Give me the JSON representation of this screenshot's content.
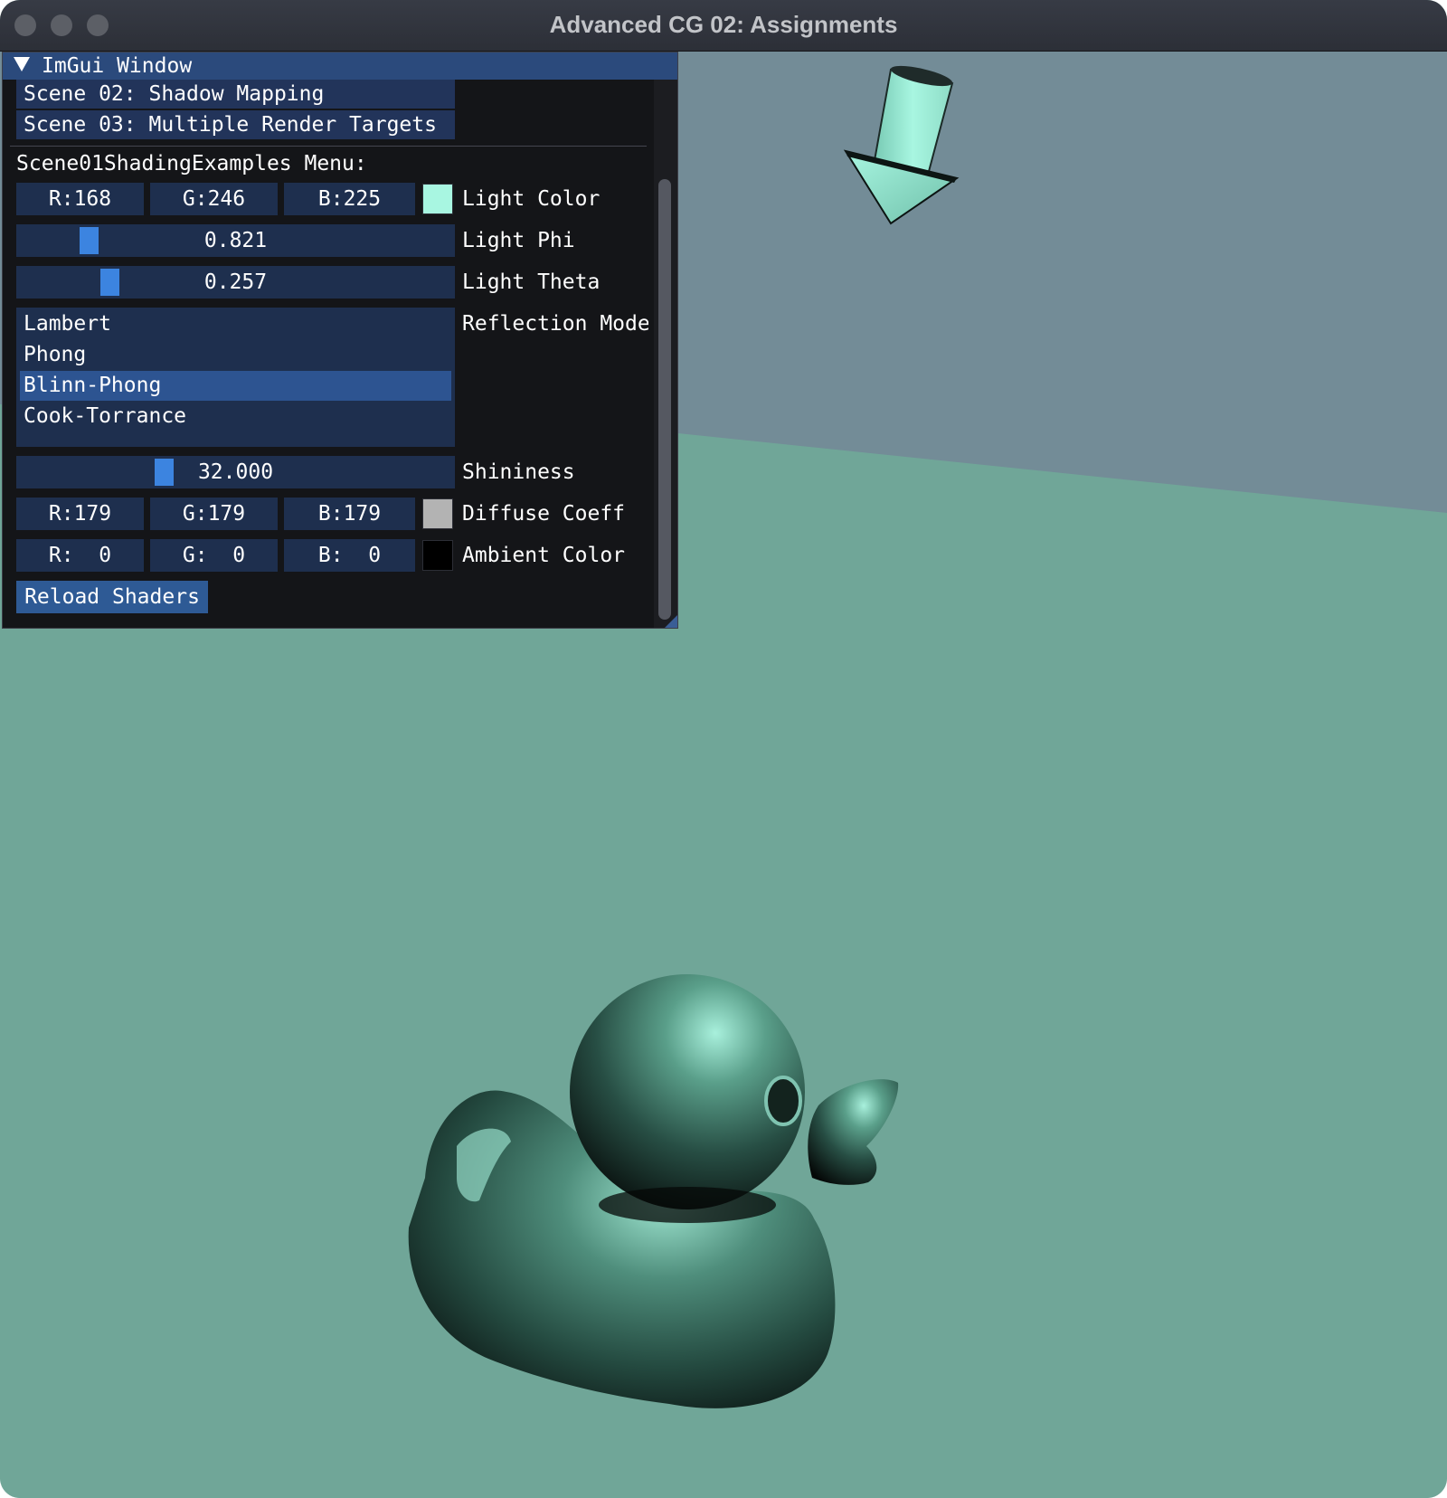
{
  "window": {
    "title": "Advanced CG 02: Assignments"
  },
  "imgui": {
    "title": "ImGui Window",
    "scene_items": [
      {
        "label": "Scene 02: Shadow Mapping"
      },
      {
        "label": "Scene 03: Multiple Render Targets"
      }
    ],
    "menu_title": "Scene01ShadingExamples Menu:",
    "light_color": {
      "r": "R:168",
      "g": "G:246",
      "b": "B:225",
      "label": "Light Color",
      "swatch": "#a8f6e1"
    },
    "light_phi": {
      "value": "0.821",
      "label": "Light Phi",
      "fraction": 0.147
    },
    "light_theta": {
      "value": "0.257",
      "label": "Light Theta",
      "fraction": 0.197
    },
    "reflection_mode": {
      "label": "Reflection Mode",
      "options": [
        "Lambert",
        "Phong",
        "Blinn-Phong",
        "Cook-Torrance"
      ],
      "selected": "Blinn-Phong"
    },
    "shininess": {
      "value": "32.000",
      "label": "Shininess",
      "fraction": 0.328
    },
    "diffuse_coeff": {
      "r": "R:179",
      "g": "G:179",
      "b": "B:179",
      "label": "Diffuse Coeff",
      "swatch": "#b3b3b3"
    },
    "ambient_color": {
      "r": "R:  0",
      "g": "G:  0",
      "b": "B:  0",
      "label": "Ambient Color",
      "swatch": "#000000"
    },
    "reload_label": "Reload Shaders"
  },
  "scene": {
    "background_color": "#738c97",
    "floor_color": "#70a698",
    "light_color": "#a8f6e1"
  }
}
